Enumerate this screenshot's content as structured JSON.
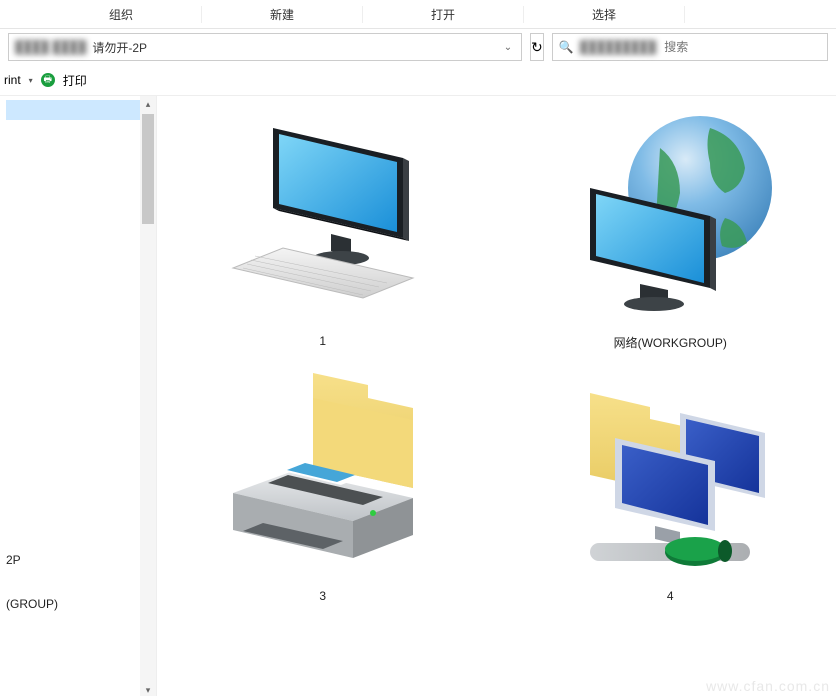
{
  "ribbon": {
    "tabs": [
      "",
      "组织",
      "新建",
      "打开",
      "选择"
    ]
  },
  "address": {
    "prefix_blur": "████  ████",
    "path_text": "请勿开-2P",
    "dropdown": "⌄"
  },
  "refresh_glyph": "↻",
  "search": {
    "icon": "🔍",
    "placeholder": "搜索",
    "value_blur": "█████████"
  },
  "toolbar": {
    "item0_suffix": "rint",
    "dropdown_glyph": "▾",
    "print_label": "打印",
    "print_icon_glyph": "🖶"
  },
  "nav": {
    "top_item_selected": "",
    "bottom_item_1": "2P",
    "bottom_item_2": "(GROUP)"
  },
  "items": [
    {
      "id": "item-1",
      "label": "1",
      "icon": "computer"
    },
    {
      "id": "item-network",
      "label": "网络(WORKGROUP)",
      "icon": "globe-monitor"
    },
    {
      "id": "item-3",
      "label": "3",
      "icon": "printer-folder"
    },
    {
      "id": "item-4",
      "label": "4",
      "icon": "folder-network-pcs"
    }
  ],
  "watermark": "www.cfan.com.cn"
}
